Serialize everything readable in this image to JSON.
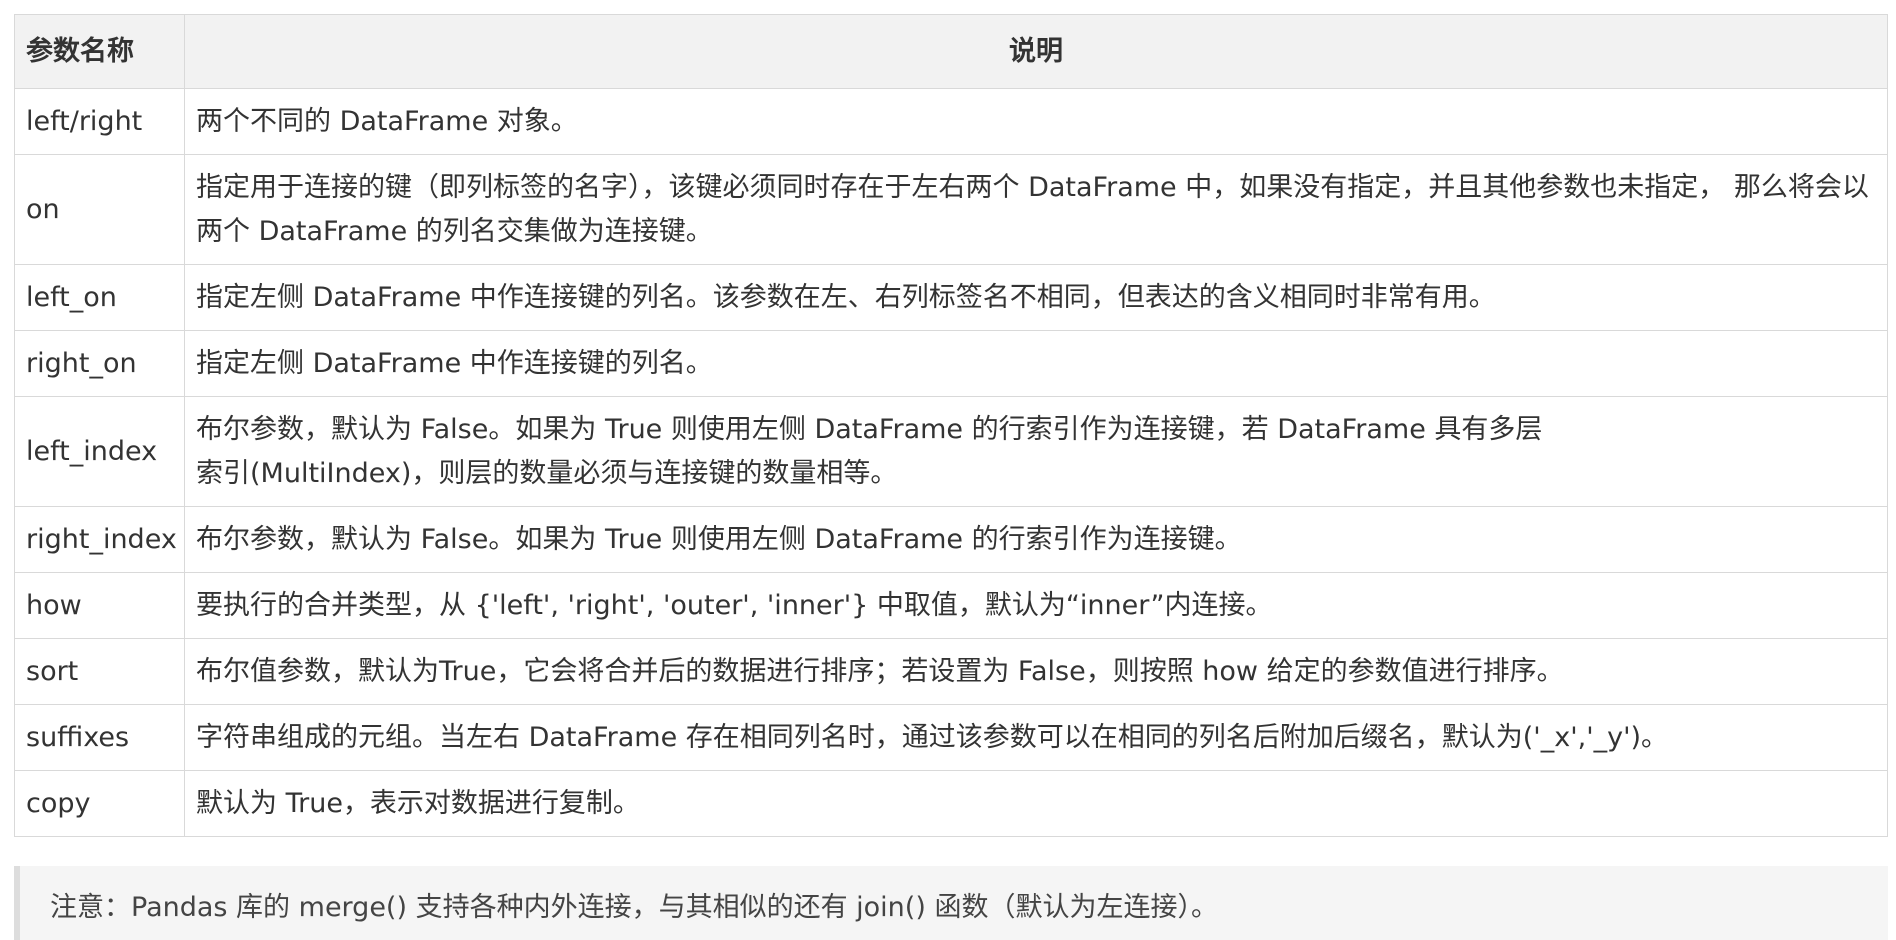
{
  "table": {
    "headers": [
      "参数名称",
      "说明"
    ],
    "rows": [
      {
        "param": "left/right",
        "desc": "两个不同的 DataFrame 对象。"
      },
      {
        "param": "on",
        "desc": "指定用于连接的键（即列标签的名字），该键必须同时存在于左右两个 DataFrame 中，如果没有指定，并且其他参数也未指定， 那么将会以两个 DataFrame 的列名交集做为连接键。"
      },
      {
        "param": "left_on",
        "desc": "指定左侧 DataFrame 中作连接键的列名。该参数在左、右列标签名不相同，但表达的含义相同时非常有用。"
      },
      {
        "param": "right_on",
        "desc": "指定左侧 DataFrame 中作连接键的列名。"
      },
      {
        "param": "left_index",
        "desc_lines": [
          "布尔参数，默认为 False。如果为 True 则使用左侧 DataFrame 的行索引作为连接键，若 DataFrame 具有多层",
          "索引(MultiIndex)，则层的数量必须与连接键的数量相等。"
        ]
      },
      {
        "param": "right_index",
        "desc": "布尔参数，默认为 False。如果为 True 则使用左侧 DataFrame 的行索引作为连接键。"
      },
      {
        "param": "how",
        "desc": "要执行的合并类型，从 {'left', 'right', 'outer', 'inner'} 中取值，默认为“inner”内连接。"
      },
      {
        "param": "sort",
        "desc": "布尔值参数，默认为True，它会将合并后的数据进行排序；若设置为 False，则按照 how 给定的参数值进行排序。"
      },
      {
        "param": "suffixes",
        "desc": "字符串组成的元组。当左右 DataFrame 存在相同列名时，通过该参数可以在相同的列名后附加后缀名，默认为('_x','_y')。"
      },
      {
        "param": "copy",
        "desc": "默认为 True，表示对数据进行复制。"
      }
    ]
  },
  "note": {
    "text": "注意：Pandas 库的 merge() 支持各种内外连接，与其相似的还有 join() 函数（默认为左连接）。"
  }
}
